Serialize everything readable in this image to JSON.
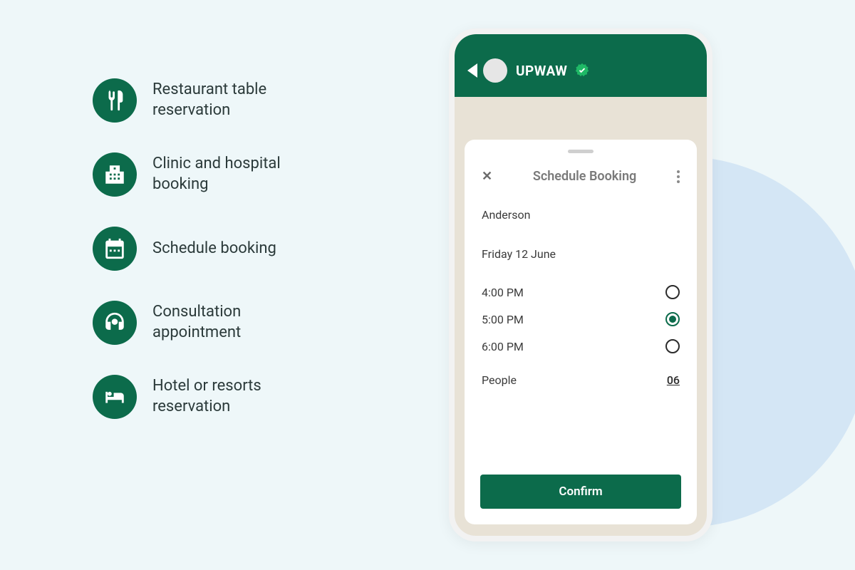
{
  "features": [
    {
      "label": "Restaurant table reservation"
    },
    {
      "label": "Clinic and hospital booking"
    },
    {
      "label": "Schedule booking"
    },
    {
      "label": "Consultation appointment"
    },
    {
      "label": "Hotel or resorts reservation"
    }
  ],
  "phone": {
    "app_name": "UPWAW",
    "sheet": {
      "title": "Schedule Booking",
      "name": "Anderson",
      "date": "Friday 12 June",
      "times": [
        {
          "label": "4:00 PM",
          "selected": false
        },
        {
          "label": "5:00 PM",
          "selected": true
        },
        {
          "label": "6:00 PM",
          "selected": false
        }
      ],
      "people_label": "People",
      "people_value": "06",
      "confirm_label": "Confirm"
    }
  }
}
